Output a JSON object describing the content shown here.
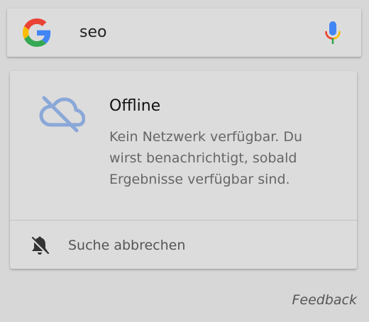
{
  "search": {
    "query": "seo"
  },
  "card": {
    "title": "Offline",
    "message": "Kein Netzwerk verfügbar. Du wirst benachrichtigt, sobald Ergebnisse verfügbar sind.",
    "cancel_label": "Suche abbrechen",
    "icon": "cloud-off-icon",
    "icon_color": "#8aa8d8"
  },
  "footer": {
    "feedback_label": "Feedback"
  },
  "colors": {
    "background": "#d7d7d7",
    "card_background": "#dcdcdc",
    "google_blue": "#4285F4",
    "google_red": "#EA4335",
    "google_yellow": "#FBBC05",
    "google_green": "#34A853"
  }
}
